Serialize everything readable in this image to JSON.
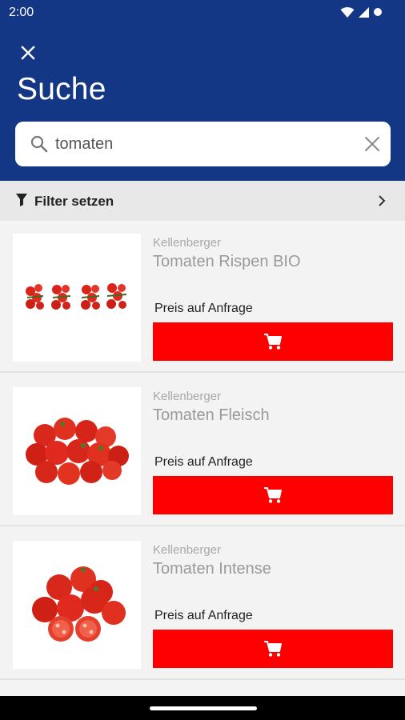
{
  "status_bar": {
    "time": "2:00",
    "icons": [
      "wifi-icon",
      "signal-icon",
      "battery-dot-icon"
    ]
  },
  "header": {
    "close_icon": "close-icon",
    "title": "Suche"
  },
  "search": {
    "value": "tomaten",
    "placeholder": "",
    "icon": "search-icon",
    "clear_icon": "clear-icon"
  },
  "filter": {
    "label": "Filter setzen",
    "icon": "filter-icon",
    "chevron": "chevron-right-icon"
  },
  "products": [
    {
      "brand": "Kellenberger",
      "name": "Tomaten Rispen BIO",
      "price": "Preis auf Anfrage",
      "image": "cherry-tomatoes-on-vine",
      "cart_icon": "cart-icon"
    },
    {
      "brand": "Kellenberger",
      "name": "Tomaten Fleisch",
      "price": "Preis auf Anfrage",
      "image": "pile-of-tomatoes",
      "cart_icon": "cart-icon"
    },
    {
      "brand": "Kellenberger",
      "name": "Tomaten Intense",
      "price": "Preis auf Anfrage",
      "image": "tomatoes-with-halves",
      "cart_icon": "cart-icon"
    }
  ],
  "colors": {
    "header_bg": "#143785",
    "cart_button": "#ff0000",
    "filter_bg": "#e8e8e8",
    "page_bg": "#f3f3f3"
  }
}
